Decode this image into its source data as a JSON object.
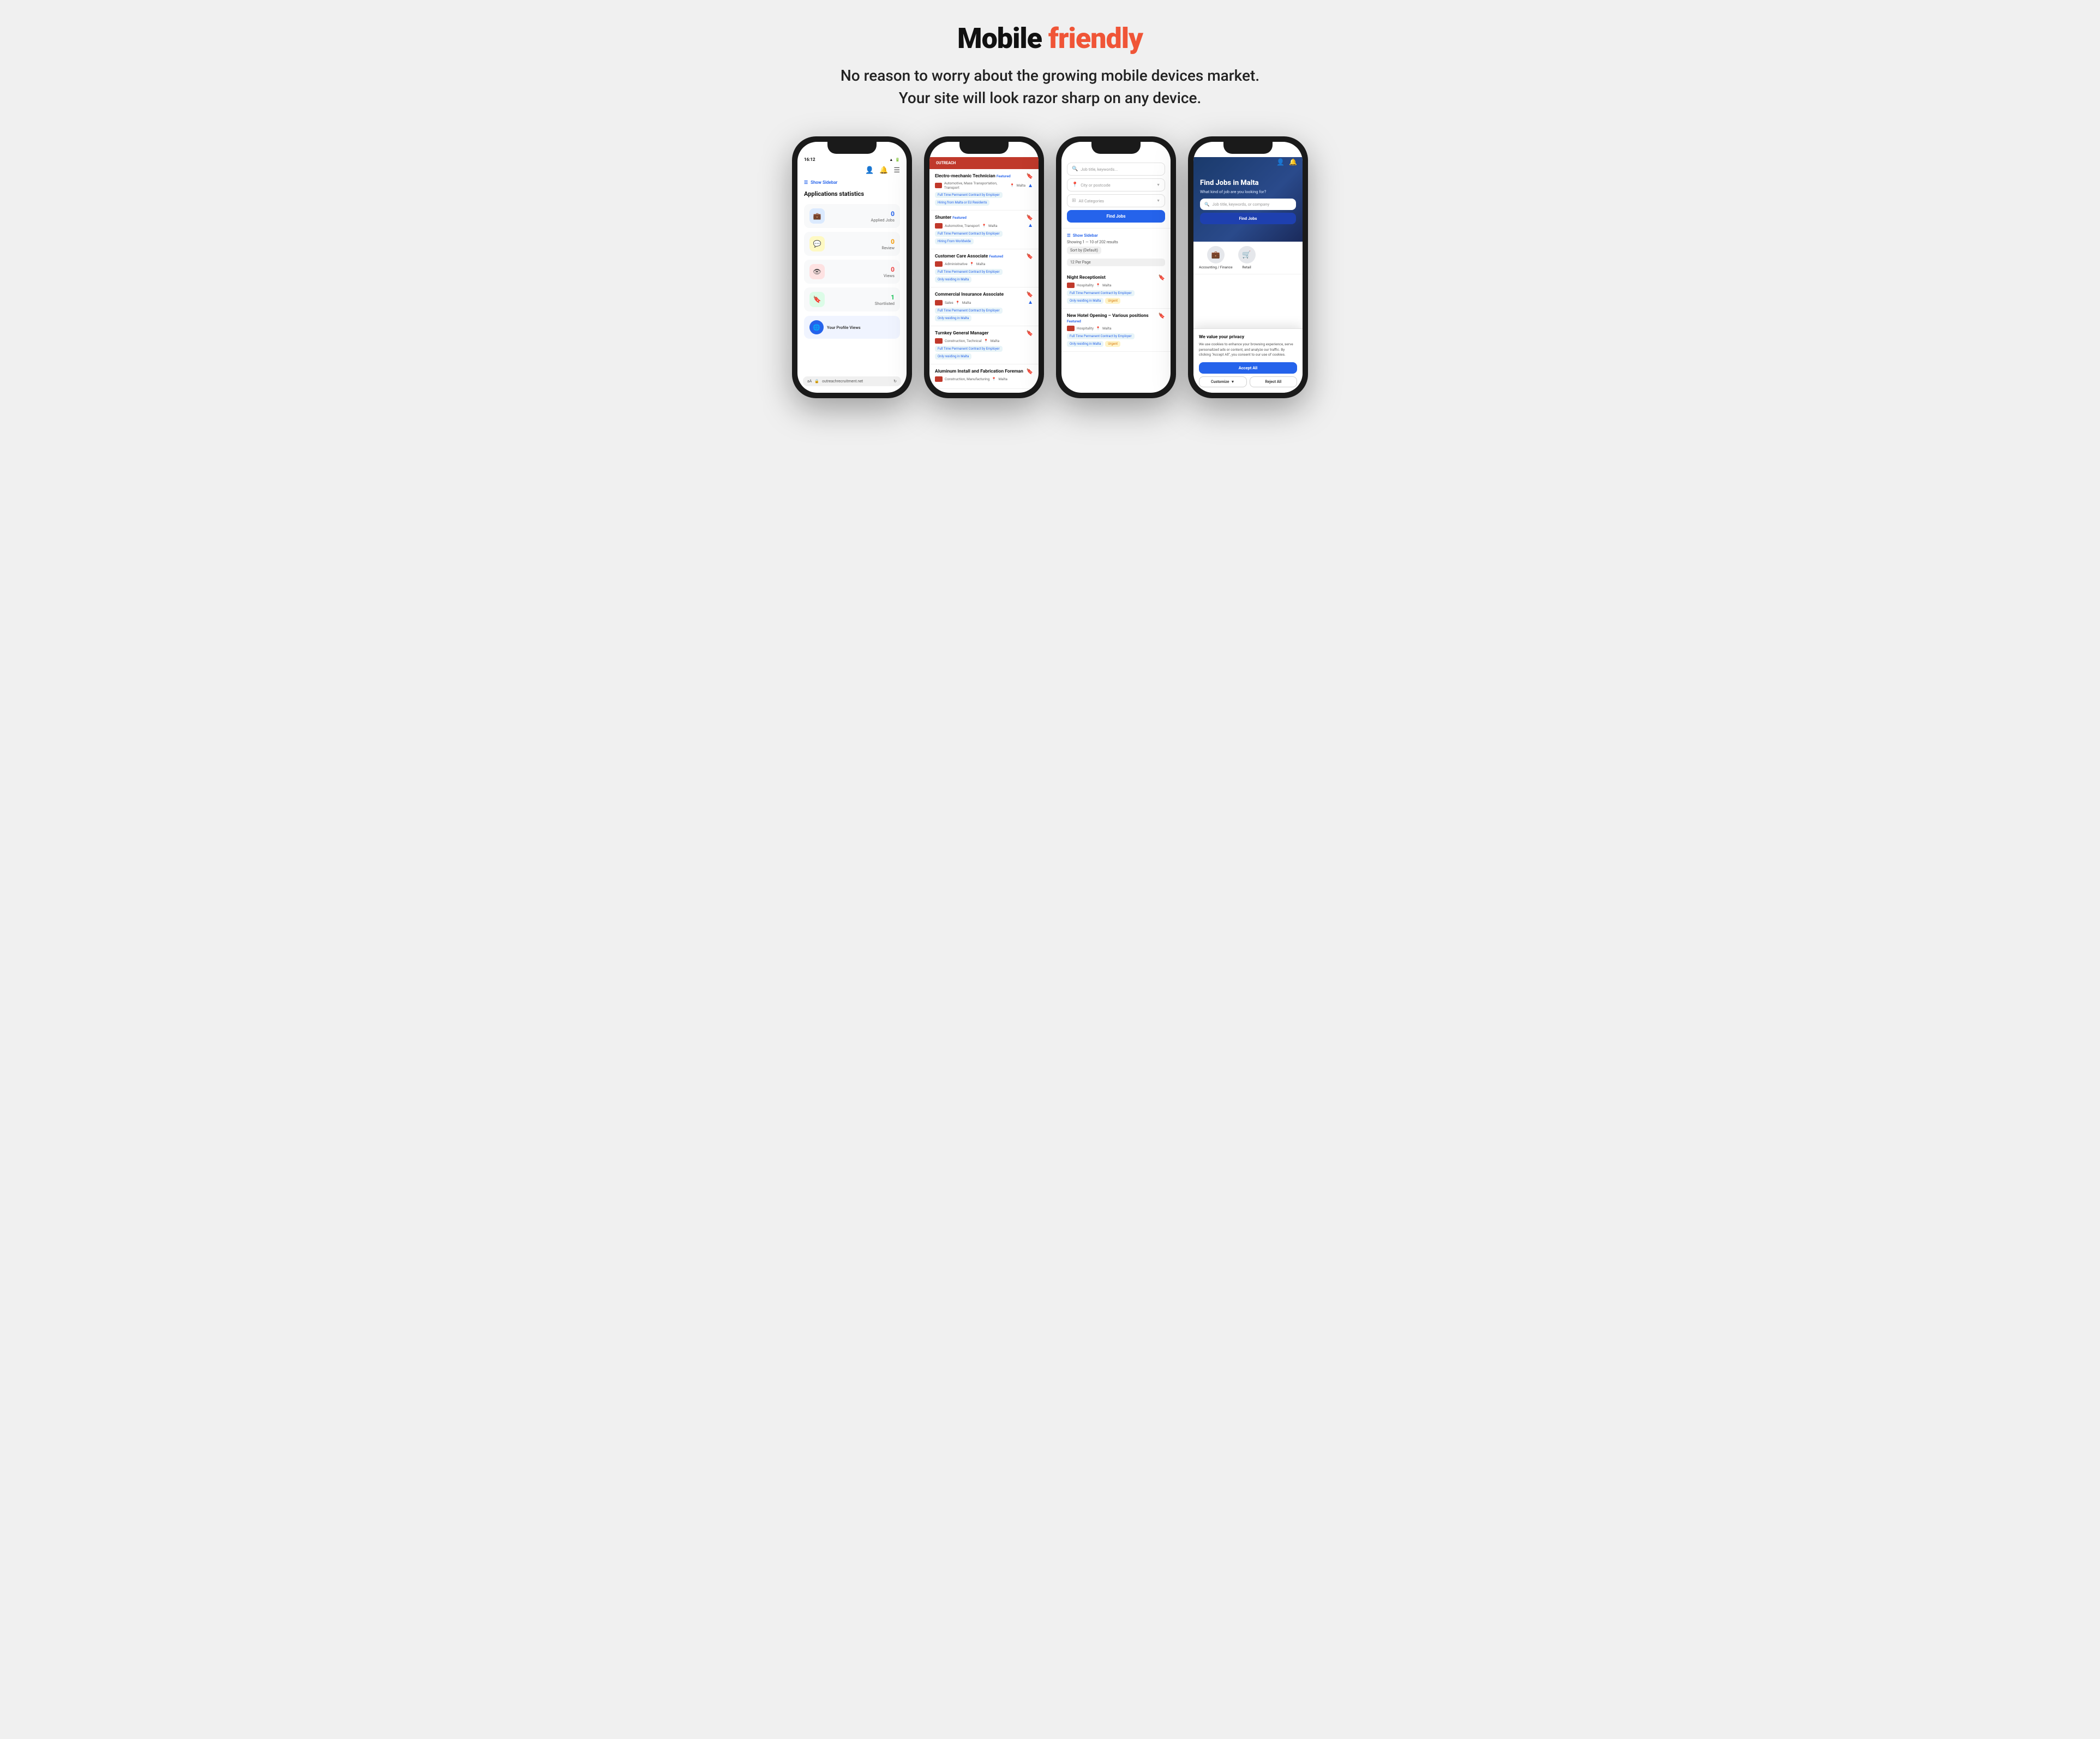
{
  "page": {
    "title_black": "Mobile ",
    "title_highlight": "friendly",
    "subtitle": "No reason to worry about the growing mobile devices market. Your site will look razor sharp on any device."
  },
  "phone1": {
    "status_time": "16:12",
    "sidebar_link": "Show Sidebar",
    "page_title": "Applications statistics",
    "stats": [
      {
        "icon": "💼",
        "color": "blue",
        "num": "0",
        "label": "Applied Jobs"
      },
      {
        "icon": "💬",
        "color": "yellow",
        "num": "0",
        "label": "Review"
      },
      {
        "icon": "👁",
        "color": "red",
        "num": "0",
        "label": "Views"
      },
      {
        "icon": "🔖",
        "color": "green",
        "num": "1",
        "label": "Shortlisted"
      }
    ],
    "profile_views": "Your Profile Views",
    "url": "outreachrecruitment.net"
  },
  "phone2": {
    "header_brand": "OUTREACH",
    "jobs": [
      {
        "title": "Electro-mechanic Technician",
        "featured": true,
        "category": "Automotive, Mass Transportation, Transport",
        "location": "Malta",
        "tags": [
          "Full Time Permanent Contract by Employer",
          "Hiring from Malta or EU Residents"
        ]
      },
      {
        "title": "Shunter",
        "featured": true,
        "category": "Automotive, Transport",
        "location": "Malta",
        "tags": [
          "Full Time Permanent Contract by Employer",
          "Hiring From Worldwide"
        ]
      },
      {
        "title": "Customer Care Associate",
        "featured": true,
        "category": "Administrative",
        "location": "Malta",
        "tags": [
          "Full Time Permanent Contract by Employer",
          "Only residing in Malta"
        ]
      },
      {
        "title": "Commercial Insurance Associate",
        "featured": false,
        "category": "Sales",
        "location": "Malta",
        "tags": [
          "Full Time Permanent Contract by Employer",
          "Only residing in Malta"
        ]
      },
      {
        "title": "Turnkey General Manager",
        "featured": false,
        "category": "Construction, Technical",
        "location": "Malta",
        "tags": [
          "Full Time Permanent Contract by Employer",
          "Only residing in Malta"
        ]
      },
      {
        "title": "Aluminum Install and Fabrication Foreman",
        "featured": false,
        "category": "Construction, Manufacturing",
        "location": "Malta",
        "tags": []
      }
    ]
  },
  "phone3": {
    "search_placeholder": "Job title, keywords...",
    "location_placeholder": "City or postcode",
    "category_placeholder": "All Categories",
    "find_jobs_btn": "Find Jobs",
    "sidebar_link": "Show Sidebar",
    "showing": "Showing 1 — 10 of 202 results",
    "sort": "Sort by (Default)",
    "per_page": "12 Per Page",
    "jobs": [
      {
        "title": "Night Receptionist",
        "category": "Hospitality",
        "location": "Malta",
        "tags": [
          "Full Time Permanent Contract by Employer",
          "Only residing in Malta"
        ],
        "urgent": true
      },
      {
        "title": "New Hotel Opening – Various positions",
        "featured": true,
        "category": "Hospitality",
        "location": "Malta",
        "tags": [
          "Full Time Permanent Contract by Employer",
          "Only residing in Malta"
        ],
        "urgent": true
      }
    ]
  },
  "phone4": {
    "hero_title": "Find Jobs in Malta",
    "hero_subtitle": "What kind of job are you looking for?",
    "search_placeholder": "Job title, keywords, or company",
    "find_jobs_btn": "Find Jobs",
    "categories": [
      {
        "icon": "💼",
        "label": "Accounting / Finance"
      },
      {
        "icon": "🛒",
        "label": "Retail"
      }
    ],
    "cookie_title": "We value your privacy",
    "cookie_text": "We use cookies to enhance your browsing experience, serve personalized ads or content, and analyze our traffic. By clicking \"Accept All\", you consent to our use of cookies.",
    "accept_all": "Accept All",
    "customize": "Customize",
    "reject_all": "Reject All"
  }
}
